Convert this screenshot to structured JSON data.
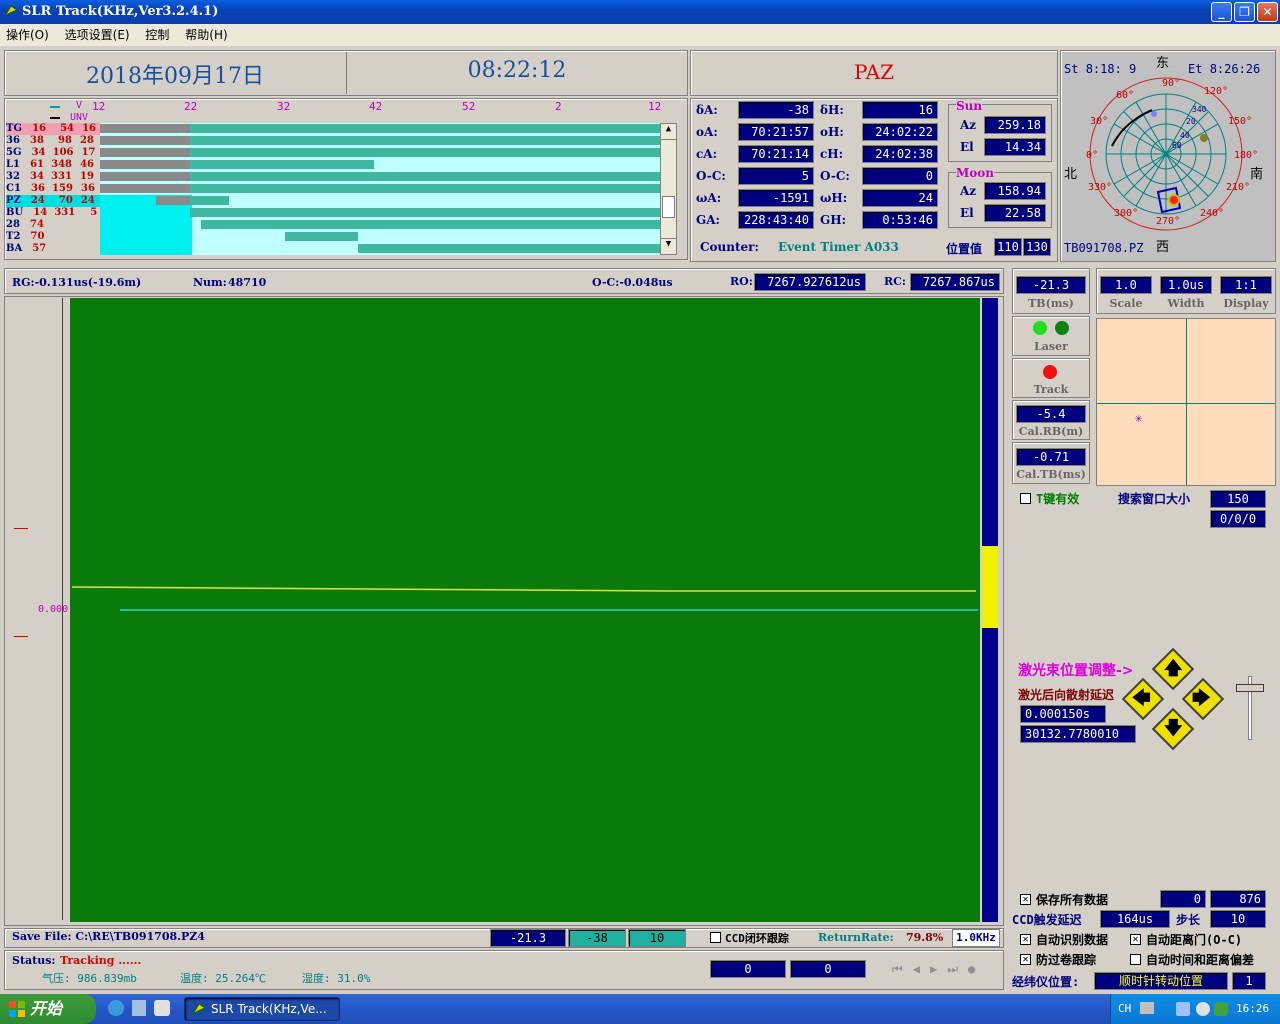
{
  "window": {
    "title": "SLR Track(KHz,Ver3.2.4.1)"
  },
  "menu": [
    "操作(O)",
    "选项设置(E)",
    "控制",
    "帮助(H)"
  ],
  "header": {
    "date": "2018年09月17日",
    "time": "08:22:12",
    "satellite": "PAZ"
  },
  "polar": {
    "st_label": "St",
    "st_time": "8:18: 9",
    "et_label": "Et",
    "et_time": "8:26:26",
    "north": "北",
    "south": "南",
    "east": "东",
    "west": "西",
    "file": "TB091708.PZ",
    "ticks": [
      "90°",
      "120°",
      "150°",
      "180°",
      "210°",
      "240°",
      "270°",
      "300°",
      "330°",
      "0°",
      "30°",
      "60°",
      "340",
      "20",
      "40",
      "60"
    ]
  },
  "timeline": {
    "legend_v": "V",
    "legend_unv": "UNV",
    "axis": [
      "12",
      "22",
      "32",
      "42",
      "52",
      "2",
      "12"
    ],
    "passes": [
      {
        "name": "TG",
        "a": "16",
        "b": "54",
        "c": "16",
        "start": 0.0,
        "end": 1.0,
        "dark_end": 0.16,
        "highlight": true
      },
      {
        "name": "36",
        "a": "38",
        "b": "98",
        "c": "28",
        "start": 0.0,
        "end": 1.0,
        "dark_end": 0.16
      },
      {
        "name": "5G",
        "a": "34",
        "b": "106",
        "c": "17",
        "start": 0.0,
        "end": 1.0,
        "dark_end": 0.16
      },
      {
        "name": "L1",
        "a": "61",
        "b": "348",
        "c": "46",
        "start": 0.0,
        "end": 0.49,
        "dark_end": 0.16
      },
      {
        "name": "32",
        "a": "34",
        "b": "331",
        "c": "19",
        "start": 0.0,
        "end": 1.0,
        "dark_end": 0.16
      },
      {
        "name": "C1",
        "a": "36",
        "b": "159",
        "c": "36",
        "start": 0.0,
        "end": 1.0,
        "dark_end": 0.16
      },
      {
        "name": "PZ",
        "a": "24",
        "b": "70",
        "c": "24",
        "start": 0.1,
        "end": 0.23,
        "dark_end": 0.16,
        "selected": true
      },
      {
        "name": "BU",
        "a": "14",
        "b": "331",
        "c": "5",
        "start": 0.16,
        "end": 1.0,
        "dark_end": 0.16
      },
      {
        "name": "28",
        "a": "74",
        "b": "",
        "c": "",
        "start": 0.18,
        "end": 1.0,
        "dark_end": 0.16
      },
      {
        "name": "T2",
        "a": "70",
        "b": "",
        "c": "",
        "start": 0.33,
        "end": 0.46,
        "dark_end": 0.16
      },
      {
        "name": "BA",
        "a": "57",
        "b": "",
        "c": "",
        "start": 0.46,
        "end": 1.0,
        "dark_end": 0.16
      }
    ]
  },
  "params": {
    "dA_lbl": "δA:",
    "dA": "-38",
    "dH_lbl": "δH:",
    "dH": "16",
    "oA_lbl": "oA:",
    "oA": "70:21:57",
    "oH_lbl": "oH:",
    "oH": "24:02:22",
    "cA_lbl": "cA:",
    "cA": "70:21:14",
    "cH_lbl": "cH:",
    "cH": "24:02:38",
    "oc1_lbl": "O-C:",
    "oc1": "5",
    "oc2_lbl": "O-C:",
    "oc2": "0",
    "wA_lbl": "ωA:",
    "wA": "-1591",
    "wH_lbl": "ωH:",
    "wH": "24",
    "GA_lbl": "GA:",
    "GA": "228:43:40",
    "GH_lbl": "GH:",
    "GH": "0:53:46",
    "counter_lbl": "Counter:",
    "counter": "Event Timer A033",
    "pos_lbl": "位置值",
    "pos1": "110",
    "pos2": "130"
  },
  "sun": {
    "title": "Sun",
    "az_lbl": "Az",
    "az": "259.18",
    "el_lbl": "El",
    "el": "14.34"
  },
  "moon": {
    "title": "Moon",
    "az_lbl": "Az",
    "az": "158.94",
    "el_lbl": "El",
    "el": "22.58"
  },
  "info": {
    "rg": "RG:-0.131us(-19.6m)",
    "num_lbl": "Num:",
    "num": "48710",
    "oc": "O-C:-0.048us",
    "ro_lbl": "RO:",
    "ro": "7267.927612us",
    "rc_lbl": "RC:",
    "rc": "7267.867us"
  },
  "plot": {
    "zero_label": "0.000"
  },
  "controls": {
    "tb": "-21.3",
    "tb_lbl": "TB(ms)",
    "scale": "1.0",
    "scale_lbl": "Scale",
    "width": "1.0us",
    "width_lbl": "Width",
    "display": "1:1",
    "display_lbl": "Display",
    "laser_lbl": "Laser",
    "track_lbl": "Track",
    "calrb": "-5.4",
    "calrb_lbl": "Cal.RB(m)",
    "caltb": "-0.71",
    "caltb_lbl": "Cal.TB(ms)",
    "tkey_lbl": "T键有效",
    "search_lbl": "搜索窗口大小",
    "search": "150",
    "search2": "0/0/0",
    "beam_lbl": "激光束位置调整->",
    "backscatter_lbl": "激光后向散射延迟",
    "bs1": "0.000150s",
    "bs2": "30132.7780010",
    "save_all_lbl": "保存所有数据",
    "save1": "0",
    "save2": "876",
    "ccd_lbl": "CCD触发延迟",
    "ccd": "164us",
    "step_lbl": "步长",
    "step": "10",
    "auto_id_lbl": "自动识别数据",
    "auto_gate_lbl": "自动距离门(O-C)",
    "anti_lbl": "防过卷跟踪",
    "auto_bias_lbl": "自动时间和距离偏差",
    "theo_lbl": "经纬仪位置:",
    "theo_btn": "顺时针转动位置",
    "theo_val": "1"
  },
  "bottom": {
    "save_file": "Save File: C:\\RE\\TB091708.PZ4",
    "v1": "-21.3",
    "v2": "-38",
    "v3": "10",
    "ccd_loop": "CCD闭环跟踪",
    "rr_lbl": "ReturnRate:",
    "rr": "79.8%",
    "khz": "1.0KHz",
    "status_lbl": "Status:",
    "status": "Tracking ......",
    "pressure": "气压: 986.839mb",
    "temp": "温度: 25.264℃",
    "humidity": "湿度: 31.0%",
    "b1": "0",
    "b2": "0"
  },
  "taskbar": {
    "start": "开始",
    "task": "SLR Track(KHz,Ve...",
    "lang": "CH",
    "clock": "16:26"
  }
}
